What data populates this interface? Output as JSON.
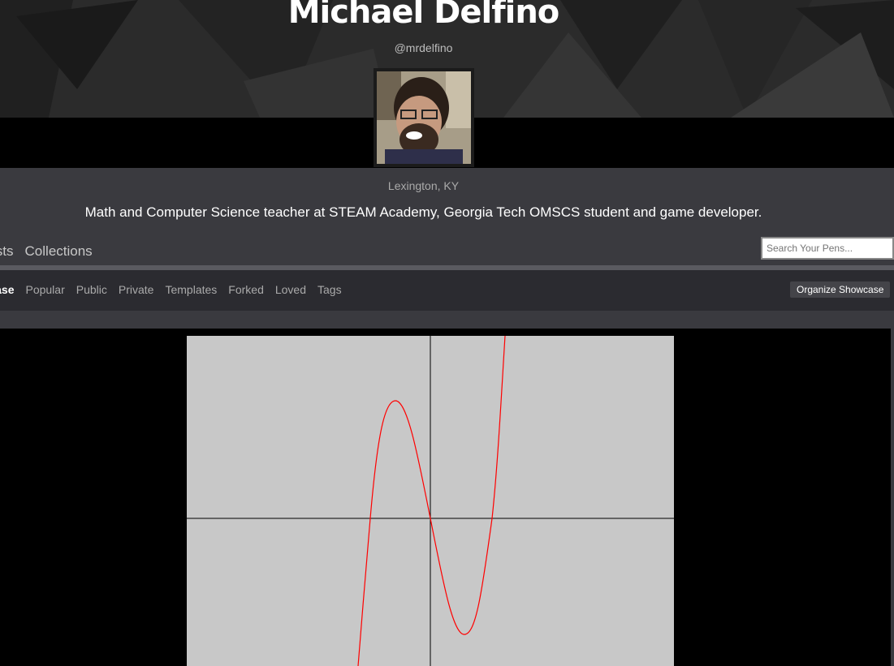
{
  "profile": {
    "name": "Michael Delfino",
    "handle": "@mrdelfino",
    "location": "Lexington, KY",
    "bio": "Math and Computer Science teacher at STEAM Academy, Georgia Tech OMSCS student and game developer."
  },
  "primary_nav": [
    "Posts",
    "Collections"
  ],
  "search": {
    "placeholder": "Search Your Pens..."
  },
  "sub_nav": {
    "items": [
      "Showcase",
      "Popular",
      "Public",
      "Private",
      "Templates",
      "Forked",
      "Loved",
      "Tags"
    ],
    "active": "Showcase"
  },
  "organize_button": "Organize Showcase",
  "pen_preview": {
    "background": "#c8c8c8",
    "curve_color": "#ff0000",
    "axis_color": "#000000"
  }
}
